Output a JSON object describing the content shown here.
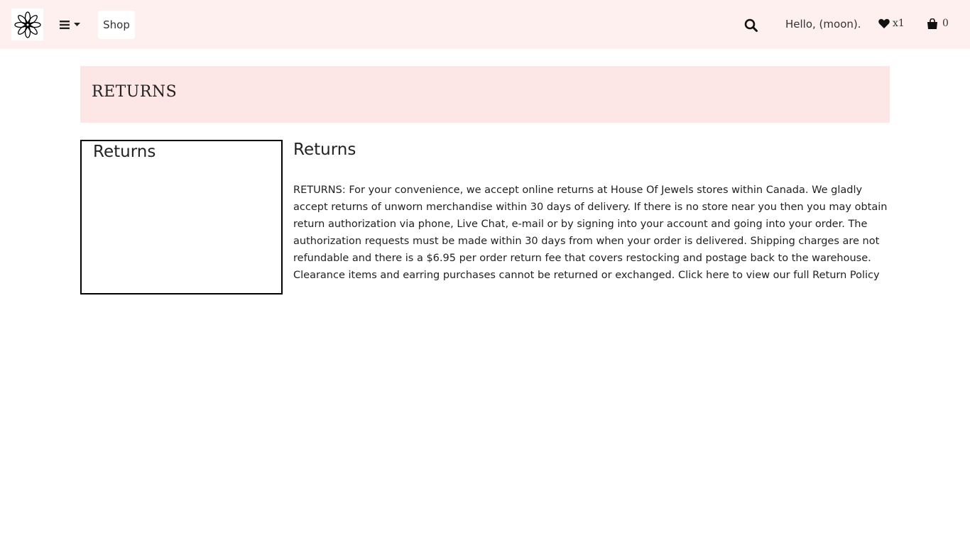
{
  "header": {
    "logo_icon": "mandala-logo-icon",
    "menu_icon": "hamburger-menu-icon",
    "caret_icon": "caret-down-icon",
    "shop_label": "Shop",
    "search_icon": "search-icon",
    "greeting": "Hello, (moon).",
    "wishlist_icon": "heart-icon",
    "wishlist_count": "x1",
    "cart_icon": "shopping-bag-icon",
    "cart_count": "0"
  },
  "page": {
    "banner_title": "RETURNS",
    "sidebar_title": "Returns",
    "content_title": "Returns",
    "body_text": "RETURNS: For your convenience, we accept online returns at House Of Jewels stores within Canada. We gladly accept returns of unworn merchandise within 30 days of delivery. If there is no store near you then you may obtain return authorization via phone, Live Chat, e-mail or by signing into your account and going into your order. The authorization requests must be made within 30 days from when your order is delivered. Shipping charges are not refundable and there is a $6.95 per order return fee that covers restocking and postage back to the warehouse. Clearance items and earring purchases cannot be returned or exchanged.",
    "link_text": "Click here to view our full Return Policy"
  },
  "colors": {
    "header_bg": "#fdf0ef",
    "banner_bg": "#fde6e6"
  }
}
